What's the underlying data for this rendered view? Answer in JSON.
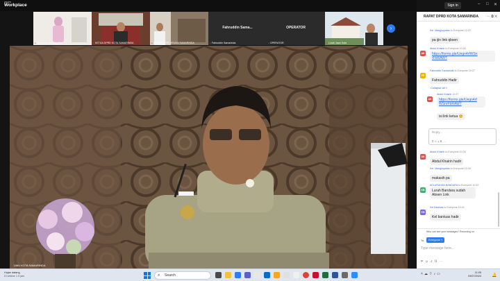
{
  "app": {
    "brand_small": "zoom",
    "brand_name": "Workplace",
    "sign_in": "Sign in"
  },
  "thumbnails": [
    {
      "label": "kelurahan Sindang Sari"
    },
    {
      "label": "KETUA DPRD KOTA SAMARINDA"
    },
    {
      "label": "SEKRETARIS DEWAN SAMARINDA"
    },
    {
      "label": "Fahruddin Samarinda",
      "name": "Fahruddin Sama..."
    },
    {
      "label": "OPERATOR",
      "name": "OPERATOR"
    },
    {
      "label": "Lurah Jaan Sala"
    }
  ],
  "main_video": {
    "label": "UMU KOTA SAMARINDA"
  },
  "chat": {
    "title": "RAPAT DPRD KOTA SAMARINDA",
    "messages": [
      {
        "sender": "Kel. Mangkupalas",
        "to": "to Everyone",
        "time": "10:22",
        "text": "pa ijin link qbsen",
        "initials": "",
        "color": "#c9c9c9"
      },
      {
        "sender": "Abdul Khairin",
        "to": "to Everyone",
        "time": "10:26",
        "text": "https://forms.gle/Uegn4rfWSn rFbRAW7",
        "initials": "AK",
        "color": "#d9534f",
        "link": true
      },
      {
        "sender": "Fahruddin Samarinda",
        "to": "to Everyone",
        "time": "10:27",
        "text": "Fahruddin Hadir",
        "initials": "FS",
        "color": "#f0b400"
      }
    ],
    "collapse": "Collapse all",
    "thread": [
      {
        "sender": "Abdul Khairin",
        "time": "10:27",
        "text": "https://forms.gle/Uegn4rf WSnrFbRAW7",
        "initials": "AK",
        "color": "#d9534f",
        "link": true
      },
      {
        "text": "isi link ketua 😊"
      }
    ],
    "reply_placeholder": "Reply...",
    "messages2": [
      {
        "sender": "Abdul Khairin",
        "to": "to Everyone",
        "time": "10:28",
        "text": "Abdul Khairin hadir",
        "initials": "AK",
        "color": "#d9534f"
      },
      {
        "sender": "Kel. Mangkupalas",
        "to": "to Everyone",
        "time": "10:28",
        "text": "makasih pa",
        "initials": "",
        "color": "#c9c9c9"
      },
      {
        "sender": "KELURAHAN BANDARA",
        "to": "to Everyone",
        "time": "10:32",
        "text": "Lurah Bandara sudah Absen Link",
        "initials": "KB",
        "color": "#3cb371"
      },
      {
        "sender": "Kel Bantuas",
        "to": "to Everyone",
        "time": "10:34",
        "text": "Kel  bantuas  hadir",
        "initials": "KB",
        "color": "#7b68ee"
      }
    ],
    "who_can_see": "Who can see your messages? Recording on",
    "to_label": "To:",
    "recipient": "Everyone",
    "input_placeholder": "Type message here..."
  },
  "taskbar": {
    "weather_title": "Hujan datang",
    "weather_sub": "Di sekitar 1.5 jam",
    "search_placeholder": "Search",
    "time": "11:05",
    "date": "03/07/2024"
  }
}
